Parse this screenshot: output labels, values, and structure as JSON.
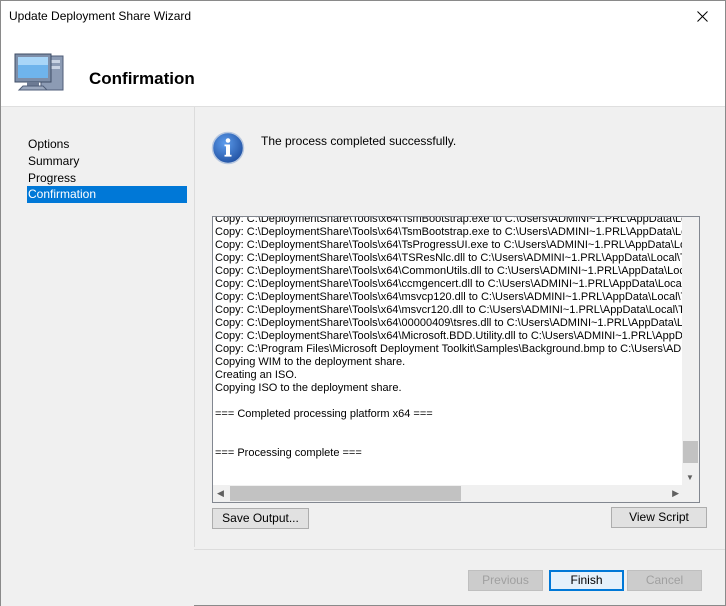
{
  "window": {
    "title": "Update Deployment Share Wizard"
  },
  "header": {
    "title": "Confirmation"
  },
  "nav": {
    "items": [
      {
        "label": "Options"
      },
      {
        "label": "Summary"
      },
      {
        "label": "Progress"
      },
      {
        "label": "Confirmation",
        "active": true
      }
    ]
  },
  "content": {
    "status_message": "The process completed successfully.",
    "log_lines": [
      "Copy: C:\\DeploymentShare\\Tools\\x64\\TsmBootstrap.exe to C:\\Users\\ADMINI~1.PRL\\AppData\\Lo",
      "Copy: C:\\DeploymentShare\\Tools\\x64\\TsmBootstrap.exe to C:\\Users\\ADMINI~1.PRL\\AppData\\Lo",
      "Copy: C:\\DeploymentShare\\Tools\\x64\\TsProgressUI.exe to C:\\Users\\ADMINI~1.PRL\\AppData\\Lo",
      "Copy: C:\\DeploymentShare\\Tools\\x64\\TSResNlc.dll to C:\\Users\\ADMINI~1.PRL\\AppData\\Local\\T",
      "Copy: C:\\DeploymentShare\\Tools\\x64\\CommonUtils.dll to C:\\Users\\ADMINI~1.PRL\\AppData\\Local",
      "Copy: C:\\DeploymentShare\\Tools\\x64\\ccmgencert.dll to C:\\Users\\ADMINI~1.PRL\\AppData\\Local",
      "Copy: C:\\DeploymentShare\\Tools\\x64\\msvcp120.dll to C:\\Users\\ADMINI~1.PRL\\AppData\\Local\\T",
      "Copy: C:\\DeploymentShare\\Tools\\x64\\msvcr120.dll to C:\\Users\\ADMINI~1.PRL\\AppData\\Local\\T",
      "Copy: C:\\DeploymentShare\\Tools\\x64\\00000409\\tsres.dll to C:\\Users\\ADMINI~1.PRL\\AppData\\Lo",
      "Copy: C:\\DeploymentShare\\Tools\\x64\\Microsoft.BDD.Utility.dll to C:\\Users\\ADMINI~1.PRL\\AppDa",
      "Copy: C:\\Program Files\\Microsoft Deployment Toolkit\\Samples\\Background.bmp to C:\\Users\\ADMIN",
      "Copying WIM to the deployment share.",
      "Creating an ISO.",
      "Copying ISO to the deployment share.",
      "",
      "=== Completed processing platform x64 ===",
      "",
      "",
      "=== Processing complete ===",
      "",
      ""
    ]
  },
  "buttons": {
    "save_output": "Save Output...",
    "view_script": "View Script",
    "previous": "Previous",
    "finish": "Finish",
    "cancel": "Cancel"
  },
  "icons": {
    "close": "close-icon",
    "header": "computer-icon",
    "info": "info-icon"
  },
  "colors": {
    "selection": "#0078d7",
    "info_blue": "#1f5fb8"
  }
}
